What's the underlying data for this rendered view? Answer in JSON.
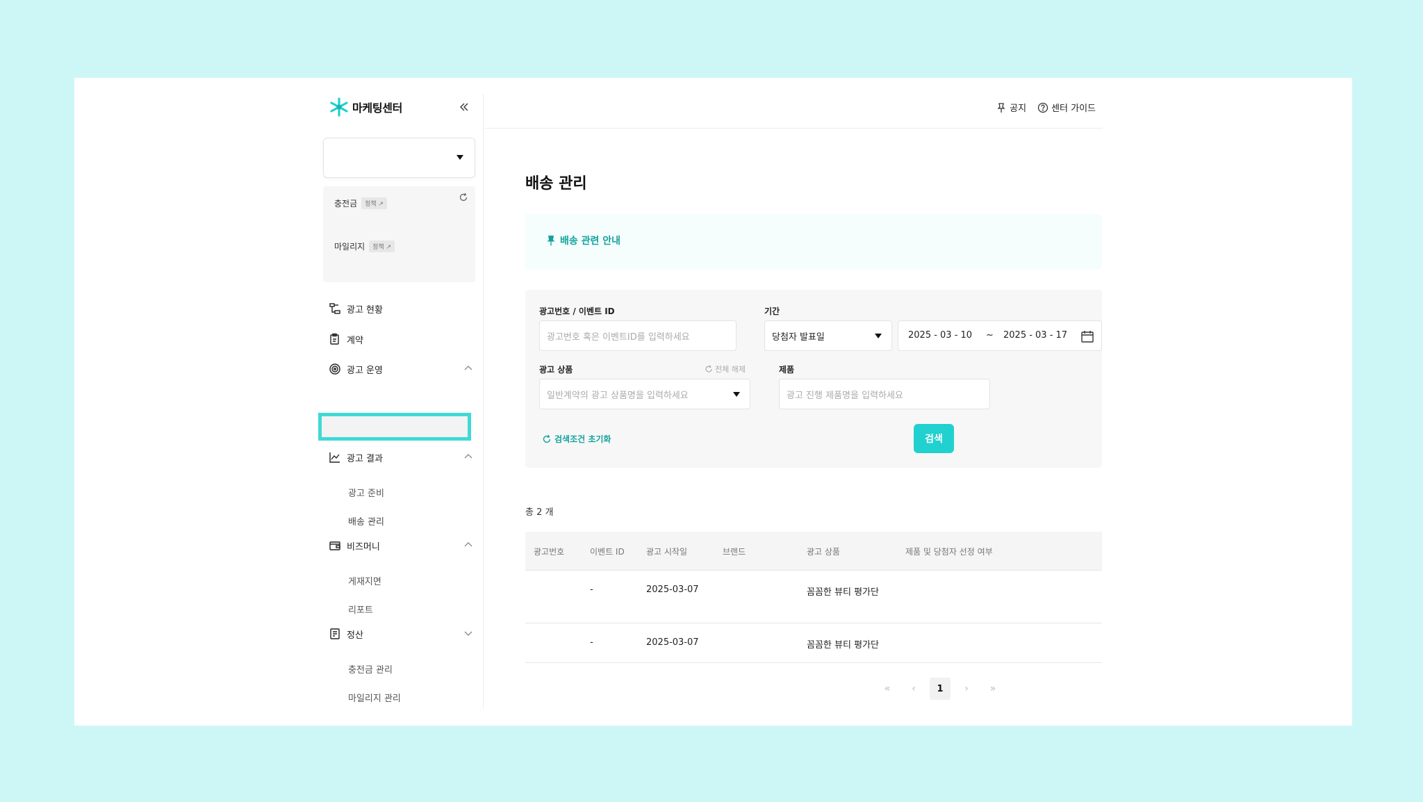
{
  "sidebar": {
    "logo_text": "마케팅센터",
    "balance": {
      "charge_label": "충전금",
      "charge_tag": "정책 ↗",
      "mileage_label": "마일리지",
      "mileage_tag": "정책 ↗"
    },
    "nav": {
      "ad_status": "광고 현황",
      "contract": "계약",
      "ad_ops": "광고 운영",
      "ad_prep": "광고 준비",
      "delivery_mgmt": "배송 관리",
      "ad_results": "광고 결과",
      "placement": "게재지면",
      "report": "리포트",
      "bizmoney": "비즈머니",
      "charge_mgmt": "충전금 관리",
      "mileage_mgmt": "마일리지 관리",
      "settlement": "정산"
    }
  },
  "topbar": {
    "notice_label": "공지",
    "guide_label": "센터 가이드"
  },
  "main": {
    "title": "배송 관리",
    "notice_text": "배송 관련 안내",
    "filter": {
      "ad_id_label": "광고번호 / 이벤트 ID",
      "ad_id_placeholder": "광고번호 혹은 이벤트ID를 입력하세요",
      "period_label": "기간",
      "period_select": "당첨자 발표일",
      "date_start": "2025 - 03 - 10",
      "date_sep": "~",
      "date_end": "2025 - 03 - 17",
      "product_label": "광고 상품",
      "clear_all": "전체 해제",
      "product_placeholder": "일반계약의 광고 상품명을 입력하세요",
      "item_label": "제품",
      "item_placeholder": "광고 진행 제품명을 입력하세요",
      "reset_label": "검색조건 초기화",
      "search_label": "검색"
    },
    "total_text": "총 2 개",
    "table": {
      "headers": [
        "광고번호",
        "이벤트 ID",
        "광고 시작일",
        "브랜드",
        "광고 상품",
        "제품 및 당첨자 선정 여부"
      ],
      "rows": [
        {
          "ad_no": "",
          "event_id": "-",
          "start": "2025-03-07",
          "brand": "",
          "product": "꼼꼼한 뷰티 평가단",
          "selection": ""
        },
        {
          "ad_no": "",
          "event_id": "-",
          "start": "2025-03-07",
          "brand": "",
          "product": "꼼꼼한 뷰티 평가단",
          "selection": ""
        }
      ]
    },
    "pagination": {
      "first": "«",
      "prev": "‹",
      "current": "1",
      "next": "›",
      "last": "»"
    }
  },
  "colors": {
    "accent": "#21d1cf",
    "accent_text": "#13a39e",
    "background": "#cdf7f7",
    "highlight_border": "#3fd9d6"
  }
}
